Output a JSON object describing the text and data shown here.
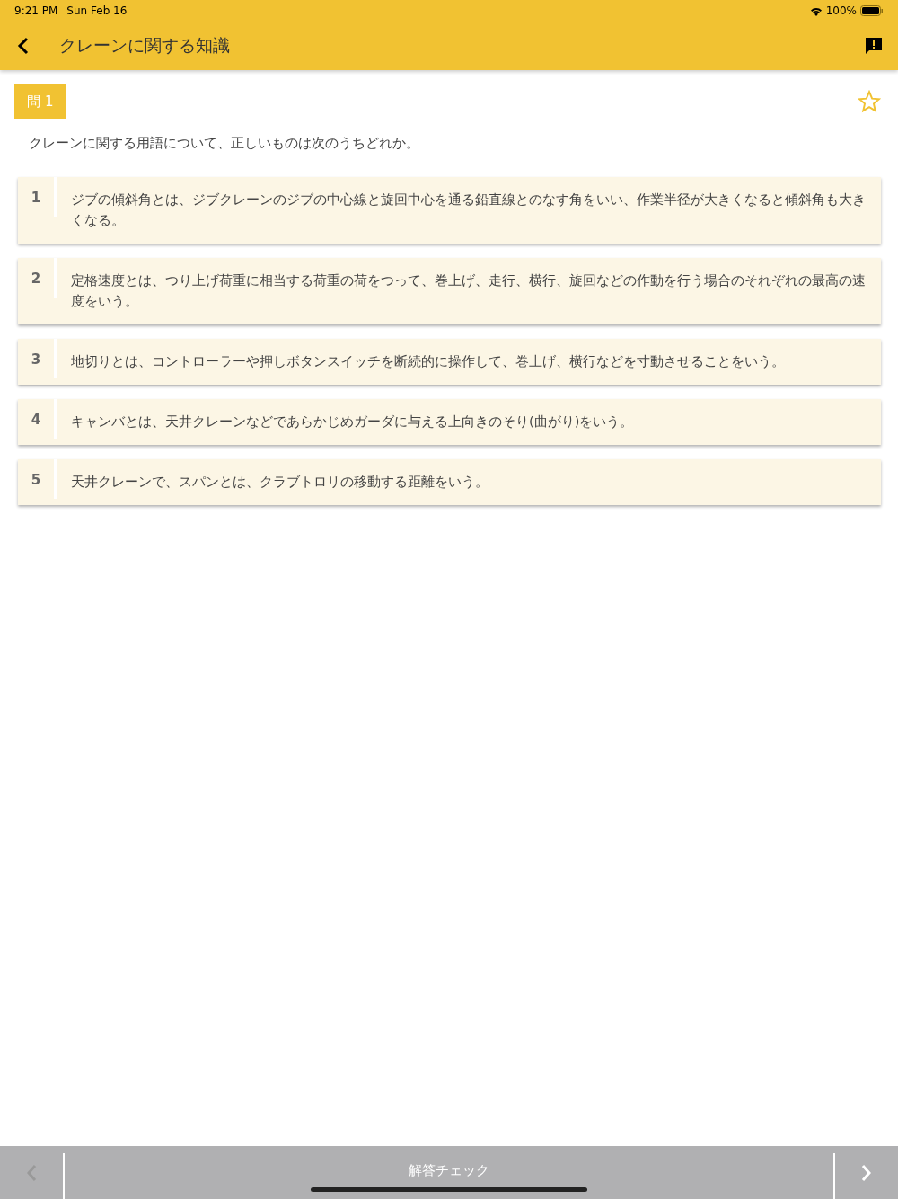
{
  "status_bar": {
    "time": "9:21 PM",
    "date": "Sun Feb 16",
    "battery": "100%"
  },
  "header": {
    "title": "クレーンに関する知識"
  },
  "question": {
    "label": "問 1",
    "starred": false,
    "text": "クレーンに関する用語について、正しいものは次のうちどれか。"
  },
  "options": [
    {
      "number": "1",
      "text": "ジブの傾斜角とは、ジブクレーンのジブの中心線と旋回中心を通る鉛直線とのなす角をいい、作業半径が大きくなると傾斜角も大きくなる。"
    },
    {
      "number": "2",
      "text": "定格速度とは、つり上げ荷重に相当する荷重の荷をつって、巻上げ、走行、横行、旋回などの作動を行う場合のそれぞれの最高の速度をいう。"
    },
    {
      "number": "3",
      "text": "地切りとは、コントローラーや押しボタンスイッチを断続的に操作して、巻上げ、横行などを寸動させることをいう。"
    },
    {
      "number": "4",
      "text": "キャンバとは、天井クレーンなどであらかじめガーダに与える上向きのそり(曲がり)をいう。"
    },
    {
      "number": "5",
      "text": "天井クレーンで、スパンとは、クラブトロリの移動する距離をいう。"
    }
  ],
  "bottom_bar": {
    "prev_disabled": true,
    "check_label": "解答チェック",
    "next_disabled": false
  }
}
